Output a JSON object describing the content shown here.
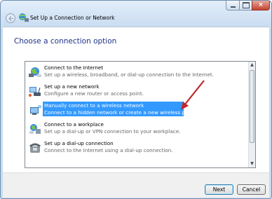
{
  "window": {
    "title": "Set Up a Connection or Network",
    "controls": {
      "close_glyph": "×"
    }
  },
  "main": {
    "heading": "Choose a connection option",
    "options": [
      {
        "title": "Connect to the Internet",
        "desc": "Set up a wireless, broadband, or dial-up connection to the Internet.",
        "icon": "globe-network-icon",
        "selected": false
      },
      {
        "title": "Set up a new network",
        "desc": "Configure a new router or access point.",
        "icon": "router-icon",
        "selected": false
      },
      {
        "title": "Manually connect to a wireless network",
        "desc": "Connect to a hidden network or create a new wireless profile.",
        "icon": "wireless-computer-icon",
        "selected": true
      },
      {
        "title": "Connect to a workplace",
        "desc": "Set up a dial-up or VPN connection to your workplace.",
        "icon": "workplace-network-icon",
        "selected": false
      },
      {
        "title": "Set up a dial-up connection",
        "desc": "Connect to the Internet using a dial-up connection.",
        "icon": "telephone-icon",
        "selected": false
      }
    ]
  },
  "footer": {
    "next_label": "Next",
    "cancel_label": "Cancel"
  },
  "colors": {
    "heading": "#1e3287",
    "selection": "#3399ff",
    "annotation_arrow": "#c0282d"
  }
}
